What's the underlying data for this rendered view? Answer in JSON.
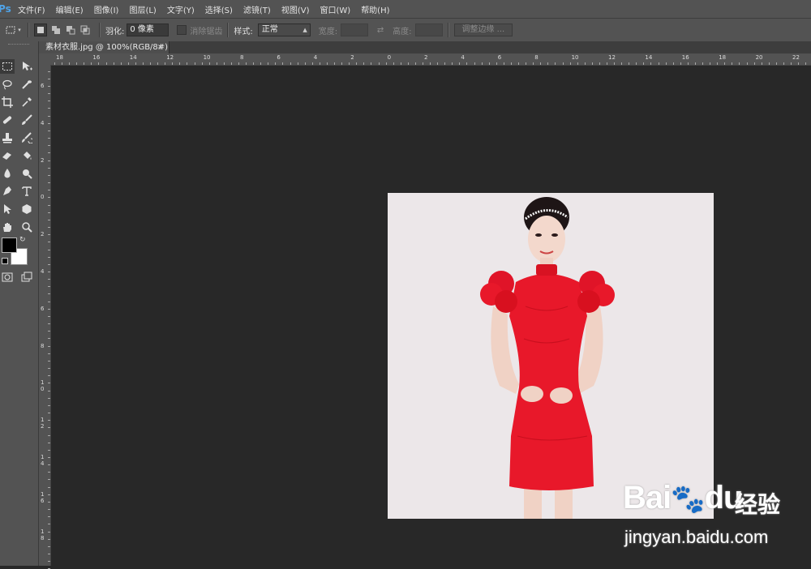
{
  "app": {
    "logo": "Ps"
  },
  "menu": [
    "文件(F)",
    "编辑(E)",
    "图像(I)",
    "图层(L)",
    "文字(Y)",
    "选择(S)",
    "滤镜(T)",
    "视图(V)",
    "窗口(W)",
    "帮助(H)"
  ],
  "options": {
    "feather_label": "羽化:",
    "feather_value": "0 像素",
    "antialias_label": "消除锯齿",
    "style_label": "样式:",
    "style_value": "正常",
    "width_label": "宽度:",
    "height_label": "高度:",
    "refine_edge": "调整边缘 ..."
  },
  "document_tab": {
    "title": "素材衣服.jpg @ 100%(RGB/8#)",
    "close": "×"
  },
  "ruler_top": [
    "18",
    "16",
    "14",
    "12",
    "10",
    "8",
    "6",
    "4",
    "2",
    "0",
    "2",
    "4",
    "6",
    "8",
    "10",
    "12",
    "14",
    "16",
    "18",
    "20",
    "22"
  ],
  "ruler_left": [
    "6",
    "4",
    "2",
    "0",
    "2",
    "4",
    "6",
    "8",
    "1\n0",
    "1\n2",
    "1\n4",
    "1\n6",
    "1\n8"
  ],
  "colors": {
    "foreground": "#000000",
    "background": "#ffffff",
    "dress": "#e8182a",
    "canvas_bg": "#282828",
    "ui_panel": "#535353"
  },
  "icons": [
    "marquee-icon",
    "move-icon",
    "lasso-icon",
    "quick-select-icon",
    "crop-icon",
    "eyedropper-icon",
    "healing-brush-icon",
    "brush-icon",
    "clone-stamp-icon",
    "history-brush-icon",
    "eraser-icon",
    "paint-bucket-icon",
    "blur-icon",
    "dodge-icon",
    "pen-icon",
    "type-icon",
    "path-select-icon",
    "shape-icon",
    "hand-icon",
    "zoom-icon"
  ],
  "watermark": {
    "brand": "Bai",
    "brand2": "du",
    "cn": "经验",
    "url": "jingyan.baidu.com"
  }
}
